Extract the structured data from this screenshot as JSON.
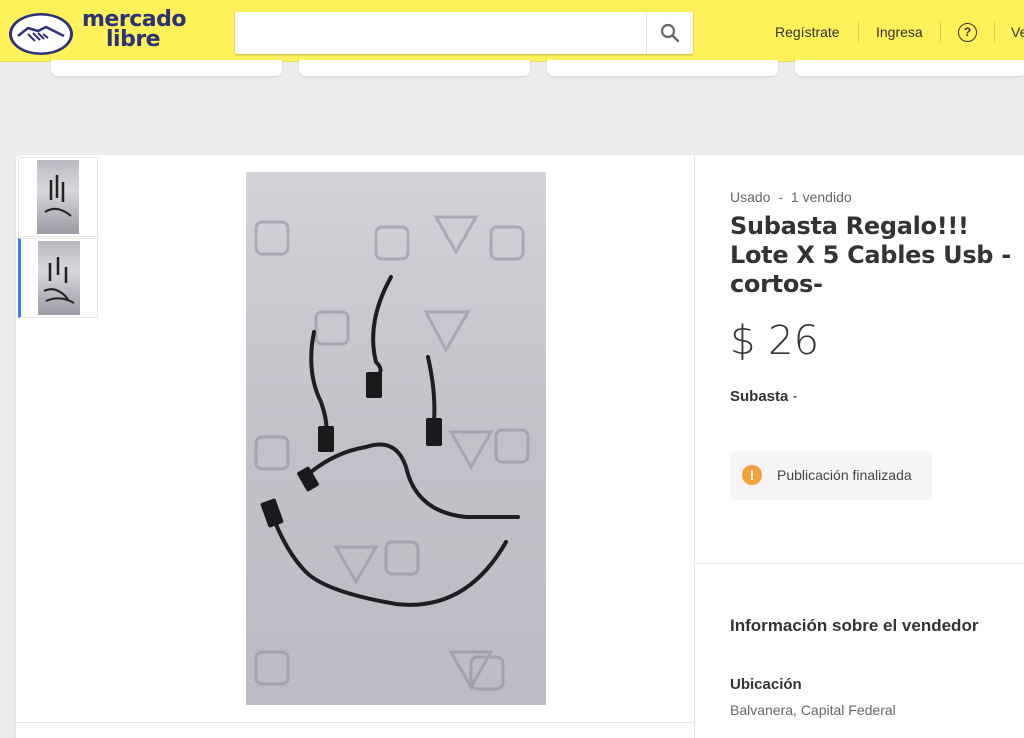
{
  "header": {
    "logo_line1": "mercado",
    "logo_line2": "libre",
    "search_placeholder": "",
    "nav": {
      "register": "Regístrate",
      "login": "Ingresa",
      "help": "?",
      "sell_partial": "Ve"
    }
  },
  "product": {
    "condition": "Usado",
    "sold": "1 vendido",
    "separator": "-",
    "title": "Subasta Regalo!!! Lote X 5 Cables Usb -cortos-",
    "price": "$ 26",
    "auction_label": "Subasta",
    "auction_suffix": "-",
    "notice": "Publicación finalizada"
  },
  "seller": {
    "heading": "Información sobre el vendedor",
    "location_label": "Ubicación",
    "location_value": "Balvanera, Capital Federal"
  },
  "colors": {
    "header_bg": "#fff159",
    "accent": "#3483fa",
    "notice_icon": "#f5a03c",
    "logo_text": "#2d3277"
  }
}
